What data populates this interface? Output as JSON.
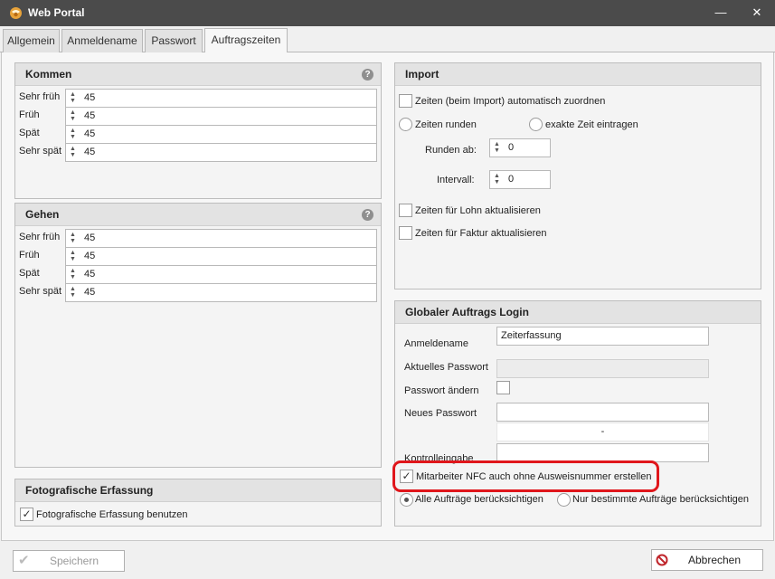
{
  "window": {
    "title": "Web Portal",
    "minimize_glyph": "—",
    "close_glyph": "✕"
  },
  "tabs": [
    {
      "label": "Allgemein"
    },
    {
      "label": "Anmeldename"
    },
    {
      "label": "Passwort"
    },
    {
      "label": "Auftragszeiten",
      "active": true
    }
  ],
  "kommen": {
    "title": "Kommen",
    "help": "?",
    "rows": [
      {
        "label": "Sehr früh",
        "value": "45"
      },
      {
        "label": "Früh",
        "value": "45"
      },
      {
        "label": "Spät",
        "value": "45"
      },
      {
        "label": "Sehr spät",
        "value": "45"
      }
    ]
  },
  "gehen": {
    "title": "Gehen",
    "help": "?",
    "rows": [
      {
        "label": "Sehr früh",
        "value": "45"
      },
      {
        "label": "Früh",
        "value": "45"
      },
      {
        "label": "Spät",
        "value": "45"
      },
      {
        "label": "Sehr spät",
        "value": "45"
      }
    ]
  },
  "foto": {
    "title": "Fotografische Erfassung",
    "checkbox_label": "Fotografische Erfassung benutzen",
    "checked": true
  },
  "import": {
    "title": "Import",
    "auto_assign_label": "Zeiten (beim Import) automatisch zuordnen",
    "round_label": "Zeiten runden",
    "exact_label": "exakte Zeit eintragen",
    "round_from_label": "Runden ab:",
    "round_from_value": "0",
    "interval_label": "Intervall:",
    "interval_value": "0",
    "lohn_label": "Zeiten für Lohn aktualisieren",
    "faktur_label": "Zeiten für Faktur aktualisieren"
  },
  "login": {
    "title": "Globaler Auftrags Login",
    "username_label": "Anmeldename",
    "username_value": "Zeiterfassung",
    "current_pw_label": "Aktuelles Passwort",
    "change_pw_label": "Passwort ändern",
    "new_pw_label": "Neues Passwort",
    "strength_text": "-",
    "confirm_label": "Kontrolleingabe",
    "nfc_label": "Mitarbeiter NFC auch ohne Ausweisnummer erstellen",
    "nfc_checked": true,
    "all_orders_label": "Alle Aufträge berücksichtigen",
    "some_orders_label": "Nur bestimmte Aufträge berücksichtigen"
  },
  "footer": {
    "save_label": "Speichern",
    "cancel_label": "Abbrechen"
  },
  "colors": {
    "titlebar": "#4b4b4b",
    "highlight": "#e0161b",
    "cancel_icon": "#c0262c"
  }
}
